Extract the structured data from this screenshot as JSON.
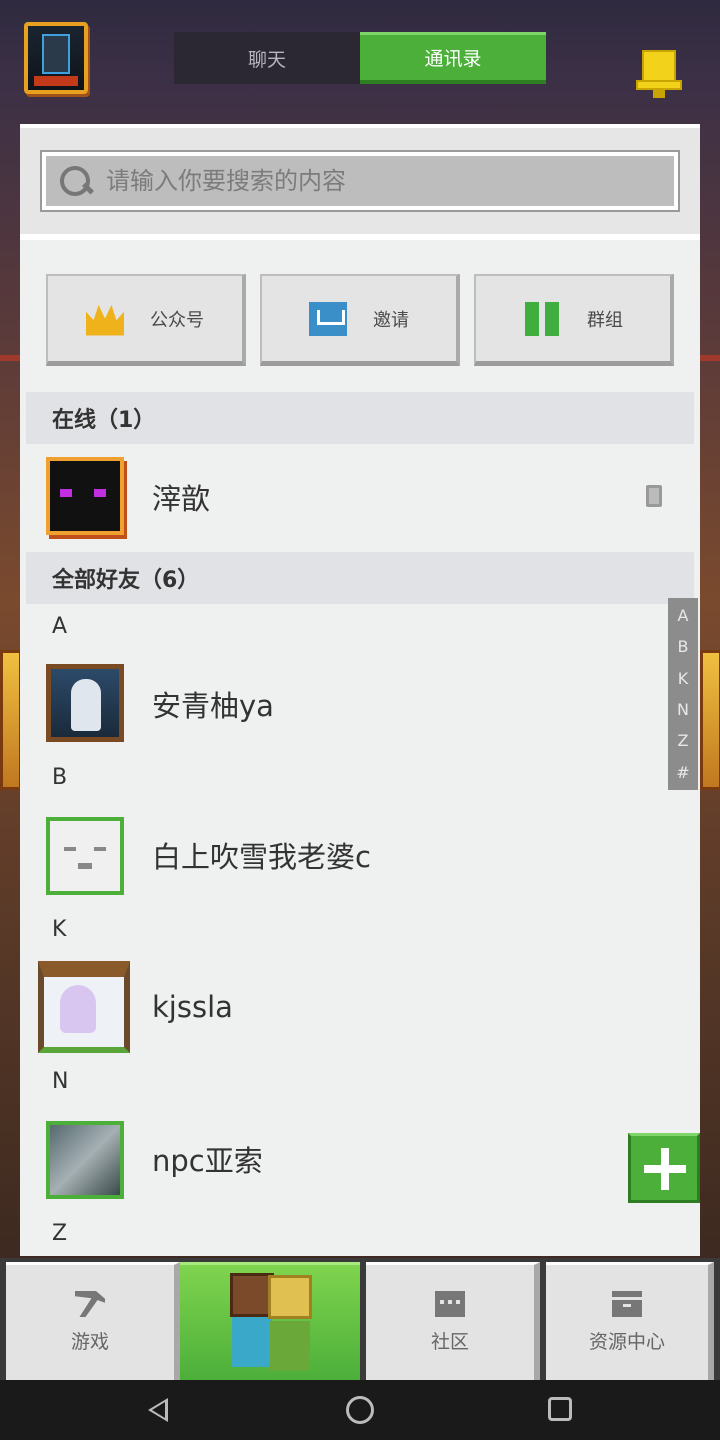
{
  "header": {
    "tabs": [
      {
        "label": "聊天",
        "active": false
      },
      {
        "label": "通讯录",
        "active": true
      }
    ]
  },
  "search": {
    "placeholder": "请输入你要搜索的内容"
  },
  "actions": [
    {
      "label": "公众号",
      "icon": "crown-icon"
    },
    {
      "label": "邀请",
      "icon": "mail-icon"
    },
    {
      "label": "群组",
      "icon": "group-icon"
    }
  ],
  "online": {
    "header": "在线（1）",
    "items": [
      {
        "name": "滓歆",
        "device": "phone-icon"
      }
    ]
  },
  "friends": {
    "header": "全部好友（6）",
    "groups": [
      {
        "letter": "A",
        "name": "安青柚ya"
      },
      {
        "letter": "B",
        "name": "白上吹雪我老婆c"
      },
      {
        "letter": "K",
        "name": "kjssla"
      },
      {
        "letter": "N",
        "name": "npc亚索"
      },
      {
        "letter": "Z"
      }
    ]
  },
  "index_bar": [
    "A",
    "B",
    "K",
    "N",
    "Z",
    "#"
  ],
  "bottom_nav": {
    "game": "游戏",
    "community": "社区",
    "resources": "资源中心"
  },
  "colors": {
    "accent": "#4caf3a",
    "panel": "#eff0f0"
  }
}
